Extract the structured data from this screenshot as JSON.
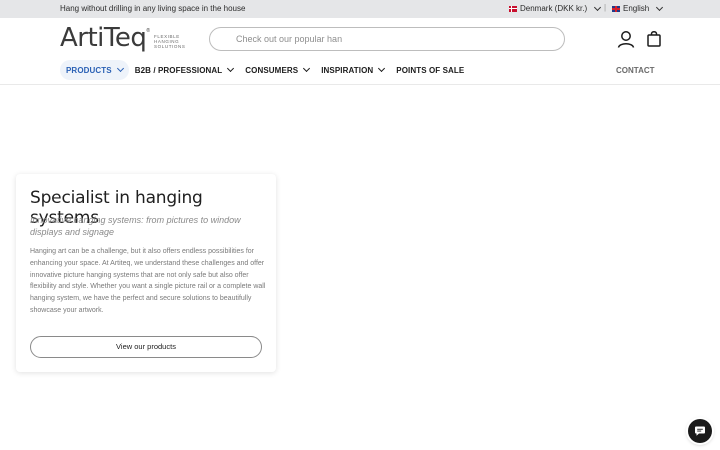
{
  "topbar": {
    "message": "Hang without drilling in any living space in the house",
    "country": "Denmark (DKK kr.)",
    "separator": "|",
    "language": "English"
  },
  "header": {
    "logo_text": "ArtiTeq",
    "logo_reg": "®",
    "logo_tagline": "FLEXIBLE HANGING SOLUTIONS",
    "search_placeholder": "Check out our popular han",
    "nav": [
      {
        "label": "PRODUCTS",
        "active": true
      },
      {
        "label": "B2B / PROFESSIONAL"
      },
      {
        "label": "CONSUMERS"
      },
      {
        "label": "INSPIRATION"
      },
      {
        "label": "POINTS OF SALE"
      }
    ],
    "contact": "CONTACT"
  },
  "hero": {
    "title": "Specialist in hanging systems",
    "subtitle": "Innovative hanging systems: from pictures to window displays and signage",
    "body": "Hanging art can be a challenge, but it also offers endless possibilities for enhancing your space. At Artiteq, we understand these challenges and offer innovative picture hanging systems that are not only safe but also offer flexibility and style. Whether you want a single picture rail or a complete wall hanging system, we have the perfect and secure solutions to beautifully showcase your artwork.",
    "cta": "View our products"
  },
  "colors": {
    "accent": "#2b61b5",
    "topbar_bg": "#e5e6e8",
    "chat_bg": "#1a1a1a"
  },
  "icons": [
    "flag-denmark-icon",
    "flag-uk-icon",
    "chevron-down-icon",
    "user-icon",
    "bag-icon",
    "chat-icon"
  ]
}
